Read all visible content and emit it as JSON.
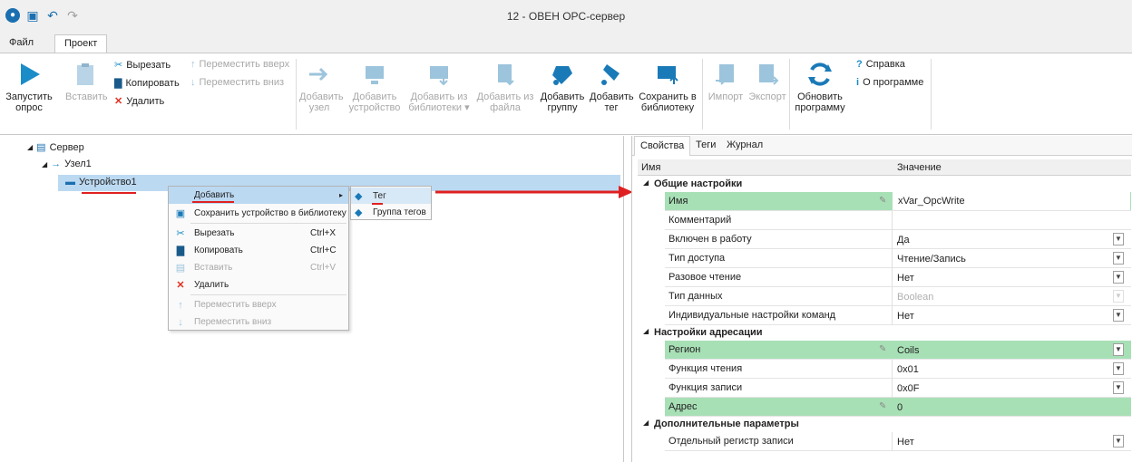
{
  "app": {
    "title": "12 - ОВЕН OPC-сервер"
  },
  "menu_tabs": [
    "Файл",
    "Проект"
  ],
  "ribbon": {
    "start_poll": "Запустить\nопрос",
    "paste": "Вставить",
    "cut": "Вырезать",
    "copy": "Копировать",
    "delete": "Удалить",
    "move_up": "Переместить вверх",
    "move_down": "Переместить вниз",
    "add_node": "Добавить\nузел",
    "add_device": "Добавить\nустройство",
    "add_from_lib": "Добавить из\nбиблиотеки ▾",
    "add_from_file": "Добавить из\nфайла",
    "add_group": "Добавить\nгруппу",
    "add_tag": "Добавить\nтег",
    "save_to_lib": "Сохранить в\nбиблиотеку",
    "import": "Импорт",
    "export": "Экспорт",
    "update": "Обновить\nпрограмму",
    "help": "Справка",
    "about": "О программе"
  },
  "tree": {
    "server": "Сервер",
    "node": "Узел1",
    "device": "Устройство1"
  },
  "context_menu": {
    "add": "Добавить",
    "save_device": "Сохранить устройство в библиотеку",
    "cut": "Вырезать",
    "cut_sc": "Ctrl+X",
    "copy": "Копировать",
    "copy_sc": "Ctrl+C",
    "paste": "Вставить",
    "paste_sc": "Ctrl+V",
    "delete": "Удалить",
    "move_up": "Переместить вверх",
    "move_down": "Переместить вниз"
  },
  "submenu": {
    "tag": "Тег",
    "tag_group": "Группа тегов"
  },
  "props": {
    "tabs": [
      "Свойства",
      "Теги",
      "Журнал"
    ],
    "col_name": "Имя",
    "col_value": "Значение",
    "cat_general": "Общие настройки",
    "cat_addr": "Настройки адресации",
    "cat_extra": "Дополнительные параметры",
    "rows_general": [
      {
        "name": "Имя",
        "value": "xVar_OpcWrite"
      },
      {
        "name": "Комментарий",
        "value": ""
      },
      {
        "name": "Включен в работу",
        "value": "Да"
      },
      {
        "name": "Тип доступа",
        "value": "Чтение/Запись"
      },
      {
        "name": "Разовое чтение",
        "value": "Нет"
      },
      {
        "name": "Тип данных",
        "value": "Boolean"
      },
      {
        "name": "Индивидуальные настройки команд",
        "value": "Нет"
      }
    ],
    "rows_addr": [
      {
        "name": "Регион",
        "value": "Coils"
      },
      {
        "name": "Функция чтения",
        "value": "0x01"
      },
      {
        "name": "Функция записи",
        "value": "0x0F"
      },
      {
        "name": "Адрес",
        "value": "0"
      }
    ],
    "rows_extra": [
      {
        "name": "Отдельный регистр записи",
        "value": "Нет"
      }
    ]
  },
  "colors": {
    "accent": "#1a8cc8",
    "highlight_green": "#a8e0b6",
    "selection": "#bcd9f2",
    "annotation_red": "#e02020"
  }
}
